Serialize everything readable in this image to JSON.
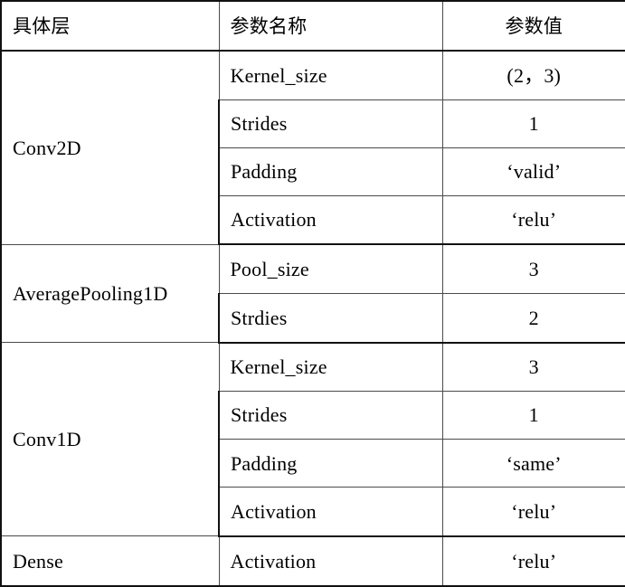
{
  "table": {
    "headers": {
      "layer": "具体层",
      "parameter_name": "参数名称",
      "parameter_value": "参数值"
    },
    "groups": [
      {
        "layer": "Conv2D",
        "rows": [
          {
            "name": "Kernel_size",
            "value": "(2，3)"
          },
          {
            "name": "Strides",
            "value": "1"
          },
          {
            "name": "Padding",
            "value": "‘valid’"
          },
          {
            "name": "Activation",
            "value": "‘relu’"
          }
        ]
      },
      {
        "layer": "AveragePooling1D",
        "rows": [
          {
            "name": "Pool_size",
            "value": "3"
          },
          {
            "name": "Strdies",
            "value": "2"
          }
        ]
      },
      {
        "layer": "Conv1D",
        "rows": [
          {
            "name": "Kernel_size",
            "value": "3"
          },
          {
            "name": "Strides",
            "value": "1"
          },
          {
            "name": "Padding",
            "value": "‘same’"
          },
          {
            "name": "Activation",
            "value": "‘relu’"
          }
        ]
      },
      {
        "layer": "Dense",
        "rows": [
          {
            "name": "Activation",
            "value": "‘relu’"
          }
        ]
      }
    ]
  },
  "style": {
    "background_color": "#ffffff",
    "text_color": "#000000",
    "border_color": "#111111",
    "inner_line_color": "#4a4a4a"
  }
}
